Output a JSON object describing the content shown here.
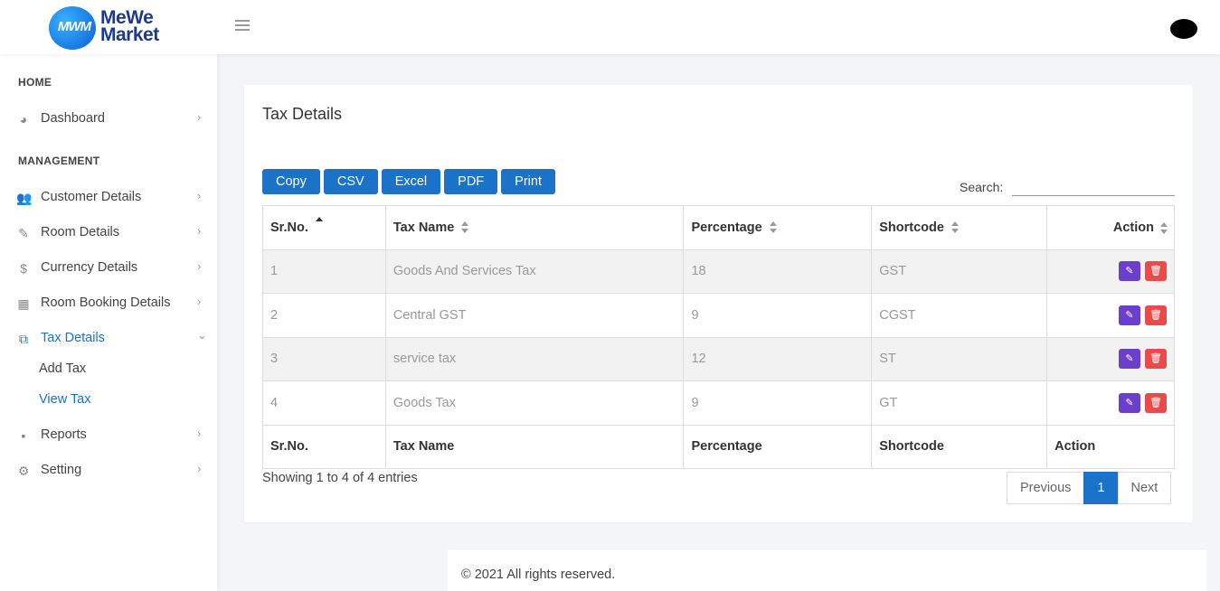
{
  "header": {
    "logo_mono": "MWM",
    "logo_line1": "MeWe",
    "logo_line2": "Market"
  },
  "sidebar": {
    "sections": {
      "home": "HOME",
      "management": "MANAGEMENT"
    },
    "items": [
      {
        "label": "Dashboard",
        "icon": "dashboard-icon"
      },
      {
        "label": "Customer Details",
        "icon": "users-icon"
      },
      {
        "label": "Room Details",
        "icon": "edit-icon"
      },
      {
        "label": "Currency Details",
        "icon": "dollar-icon"
      },
      {
        "label": "Room Booking Details",
        "icon": "grid-icon"
      },
      {
        "label": "Tax Details",
        "icon": "tax-icon"
      },
      {
        "label": "Reports",
        "icon": "report-icon"
      },
      {
        "label": "Setting",
        "icon": "gear-icon"
      }
    ],
    "tax_sub": {
      "add": "Add Tax",
      "view": "View Tax"
    }
  },
  "card": {
    "title": "Tax Details",
    "buttons": {
      "copy": "Copy",
      "csv": "CSV",
      "excel": "Excel",
      "pdf": "PDF",
      "print": "Print"
    },
    "search_label": "Search:",
    "search_value": ""
  },
  "table": {
    "headers": {
      "srno": "Sr.No.",
      "name": "Tax Name",
      "percentage": "Percentage",
      "shortcode": "Shortcode",
      "action": "Action"
    },
    "rows": [
      {
        "srno": "1",
        "name": "Goods And Services Tax",
        "percentage": "18",
        "shortcode": "GST"
      },
      {
        "srno": "2",
        "name": "Central GST",
        "percentage": "9",
        "shortcode": "CGST"
      },
      {
        "srno": "3",
        "name": "service tax",
        "percentage": "12",
        "shortcode": "ST"
      },
      {
        "srno": "4",
        "name": "Goods Tax",
        "percentage": "9",
        "shortcode": "GT"
      }
    ]
  },
  "info": "Showing 1 to 4 of 4 entries",
  "pager": {
    "previous": "Previous",
    "current": "1",
    "next": "Next"
  },
  "footer": "© 2021 All rights reserved.",
  "colors": {
    "accent": "#1a73c9",
    "edit": "#6b3fc9",
    "delete": "#e94b4b"
  }
}
